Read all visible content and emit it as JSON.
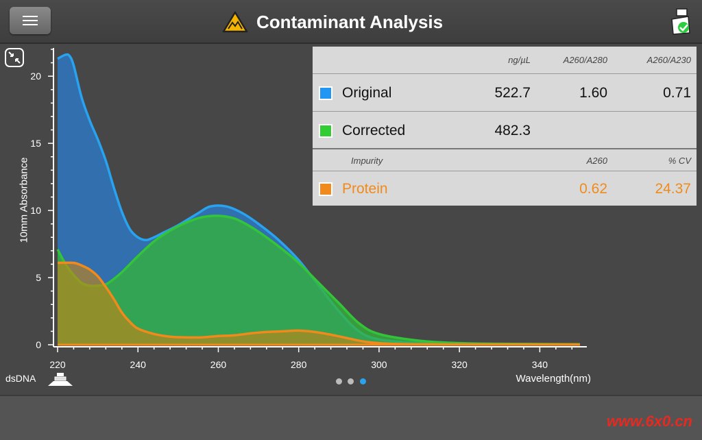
{
  "header": {
    "title": "Contaminant Analysis",
    "menu_icon": "menu-icon",
    "title_icon": "contaminant-warning-icon",
    "report_icon": "report-check-icon"
  },
  "results": {
    "headers": [
      "",
      "ng/µL",
      "A260/A280",
      "A260/A230"
    ],
    "rows": [
      {
        "label": "Original",
        "color": "#2196f3",
        "values": [
          "522.7",
          "1.60",
          "0.71"
        ]
      },
      {
        "label": "Corrected",
        "color": "#32cd32",
        "values": [
          "482.3",
          "",
          ""
        ]
      }
    ],
    "impurity_headers": [
      "Impurity",
      "A260",
      "% CV"
    ],
    "impurity": {
      "label": "Protein",
      "color": "#f08a1c",
      "values": [
        "0.62",
        "24.37"
      ]
    }
  },
  "footer": {
    "sample_type": "dsDNA",
    "page_count": 3,
    "active_page": 3
  },
  "watermark": "www.6x0.cn",
  "chart_data": {
    "type": "area",
    "xlabel": "Wavelength(nm)",
    "ylabel": "10mm Absorbance",
    "xlim": [
      220,
      350
    ],
    "ylim": [
      0,
      22
    ],
    "xticks": [
      220,
      240,
      260,
      280,
      300,
      320,
      340
    ],
    "yticks": [
      0,
      5,
      10,
      15,
      20
    ],
    "series": [
      {
        "name": "Original",
        "color": "#29a3ef",
        "x": [
          220,
          222,
          223,
          224,
          226,
          228,
          230,
          232,
          234,
          236,
          238,
          240,
          242,
          244,
          246,
          250,
          255,
          258,
          262,
          266,
          270,
          275,
          280,
          285,
          290,
          295,
          300,
          310,
          320,
          330,
          340,
          350
        ],
        "y": [
          21.3,
          21.6,
          21.5,
          20.8,
          18.4,
          16.7,
          15.3,
          13.7,
          11.7,
          9.9,
          8.6,
          8.0,
          7.8,
          8.0,
          8.3,
          8.9,
          9.8,
          10.3,
          10.3,
          9.8,
          9.0,
          7.8,
          6.3,
          4.4,
          2.5,
          1.0,
          0.4,
          0.12,
          0.06,
          0.05,
          0.04,
          0.03
        ]
      },
      {
        "name": "Corrected",
        "color": "#33c43a",
        "x": [
          220,
          222,
          224,
          226,
          228,
          230,
          232,
          234,
          236,
          238,
          240,
          244,
          248,
          252,
          256,
          260,
          264,
          268,
          272,
          276,
          280,
          285,
          290,
          295,
          300,
          310,
          320,
          330,
          340,
          350
        ],
        "y": [
          7.1,
          6.0,
          5.2,
          4.6,
          4.4,
          4.4,
          4.5,
          4.9,
          5.4,
          6.0,
          6.6,
          7.7,
          8.5,
          9.1,
          9.5,
          9.6,
          9.4,
          8.8,
          8.0,
          7.1,
          6.1,
          4.6,
          3.1,
          1.6,
          0.8,
          0.3,
          0.12,
          0.07,
          0.05,
          0.03
        ]
      },
      {
        "name": "Protein",
        "color": "#f08a1c",
        "x": [
          220,
          224,
          226,
          228,
          230,
          232,
          234,
          236,
          238,
          240,
          244,
          248,
          252,
          256,
          260,
          264,
          268,
          272,
          276,
          280,
          284,
          288,
          292,
          296,
          300,
          305,
          310,
          320,
          330,
          340,
          350
        ],
        "y": [
          6.1,
          6.1,
          5.9,
          5.6,
          5.1,
          4.3,
          3.4,
          2.4,
          1.7,
          1.2,
          0.8,
          0.6,
          0.55,
          0.55,
          0.65,
          0.7,
          0.85,
          0.95,
          1.0,
          1.05,
          0.95,
          0.75,
          0.5,
          0.25,
          0.12,
          0.05,
          0.03,
          0.02,
          0.02,
          0.02,
          0.02
        ]
      }
    ]
  }
}
